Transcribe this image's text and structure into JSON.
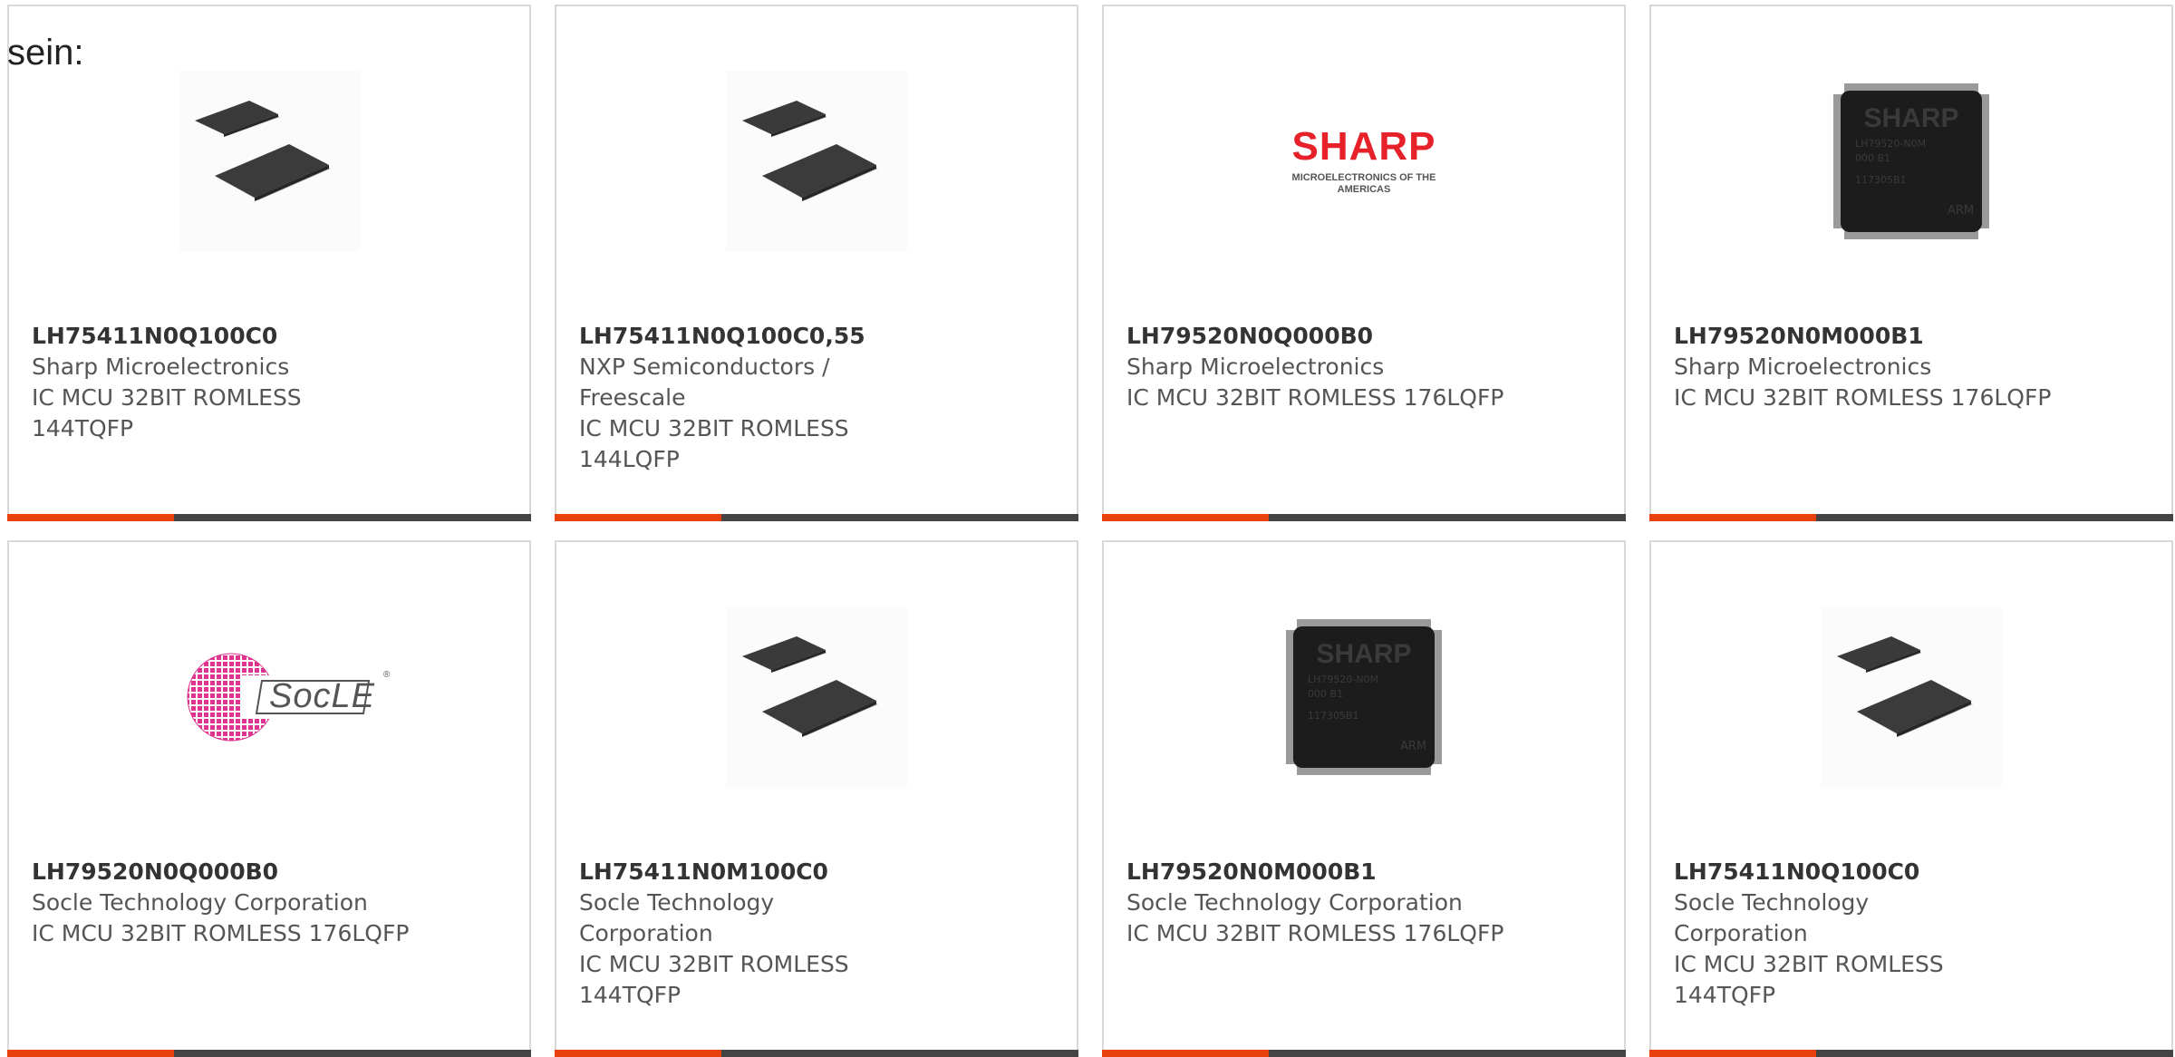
{
  "intro_text": "sein:",
  "colors": {
    "accent": "#e8410c",
    "bar": "#444444",
    "border": "#d9d9d9",
    "sharp_red": "#e6212a",
    "socle_pink": "#e0338f"
  },
  "cards": [
    {
      "part_number": "LH75411N0Q100C0",
      "manufacturer": "Sharp Microelectronics",
      "description": "IC MCU 32BIT ROMLESS 144TQFP",
      "image": "chip-package-icon"
    },
    {
      "part_number": "LH75411N0Q100C0,55",
      "manufacturer": "NXP Semiconductors / Freescale",
      "description": "IC MCU 32BIT ROMLESS 144LQFP",
      "image": "chip-package-icon"
    },
    {
      "part_number": "LH79520N0Q000B0",
      "manufacturer": "Sharp Microelectronics",
      "description": "IC MCU 32BIT ROMLESS 176LQFP",
      "image": "sharp-logo",
      "logo_word": "SHARP",
      "logo_subtitle": "MICROELECTRONICS OF THE AMERICAS"
    },
    {
      "part_number": "LH79520N0M000B1",
      "manufacturer": "Sharp Microelectronics",
      "description": "IC MCU 32BIT ROMLESS 176LQFP",
      "image": "sharp-chip-icon",
      "chip_markings": [
        "SHARP",
        "LH79520-N0M",
        "000 B1",
        "117305B1",
        "ARM"
      ]
    },
    {
      "part_number": "LH79520N0Q000B0",
      "manufacturer": "Socle Technology Corporation",
      "description": "IC MCU 32BIT ROMLESS 176LQFP",
      "image": "socle-logo",
      "logo_word": "SocLE"
    },
    {
      "part_number": "LH75411N0M100C0",
      "manufacturer": "Socle Technology Corporation",
      "description": "IC MCU 32BIT ROMLESS 144TQFP",
      "image": "chip-package-icon"
    },
    {
      "part_number": "LH79520N0M000B1",
      "manufacturer": "Socle Technology Corporation",
      "description": "IC MCU 32BIT ROMLESS 176LQFP",
      "image": "sharp-chip-icon",
      "chip_markings": [
        "SHARP",
        "LH79520-N0M",
        "000 B1",
        "117305B1",
        "ARM"
      ]
    },
    {
      "part_number": "LH75411N0Q100C0",
      "manufacturer": "Socle Technology Corporation",
      "description": "IC MCU 32BIT ROMLESS 144TQFP",
      "image": "chip-package-icon"
    }
  ]
}
